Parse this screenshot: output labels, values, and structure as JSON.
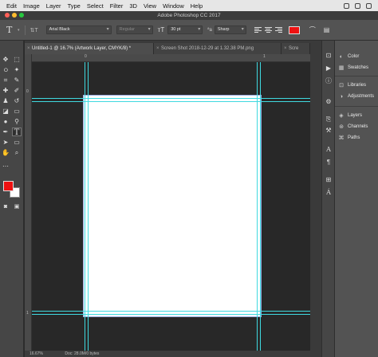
{
  "menubar": {
    "items": [
      "Edit",
      "Image",
      "Layer",
      "Type",
      "Select",
      "Filter",
      "3D",
      "View",
      "Window",
      "Help"
    ]
  },
  "window": {
    "title": "Adobe Photoshop CC 2017"
  },
  "options_bar": {
    "tool_glyph": "T",
    "font_family": "Arial Black",
    "font_style": "Regular",
    "font_size": "30 pt",
    "anti_alias": "Sharp",
    "text_color": "#ee1111"
  },
  "tabs": [
    {
      "label": "Untitled-1 @ 16.7% (Artwork Layer, CMYK/8) *",
      "active": true
    },
    {
      "label": "Screen Shot 2018-12-29 at 1.32.38 PM.png",
      "active": false
    },
    {
      "label": "Scre",
      "active": false
    }
  ],
  "rulers": {
    "h_labels": [
      "0",
      "1"
    ],
    "v_labels": [
      "0",
      "1"
    ]
  },
  "status": {
    "zoom": "16.67%",
    "doc": "Doc: 28.0M/0 bytes"
  },
  "tools": {
    "foreground_color": "#ee1111",
    "background_color": "#ffffff"
  },
  "panels": {
    "group1": [
      "Color",
      "Swatches"
    ],
    "group2": [
      "Libraries",
      "Adjustments"
    ],
    "group3": [
      "Layers",
      "Channels",
      "Paths"
    ]
  },
  "colors": {
    "guides": "#3fd9e0",
    "canvas_bg": "#282828",
    "artboard": "#ffffff"
  }
}
